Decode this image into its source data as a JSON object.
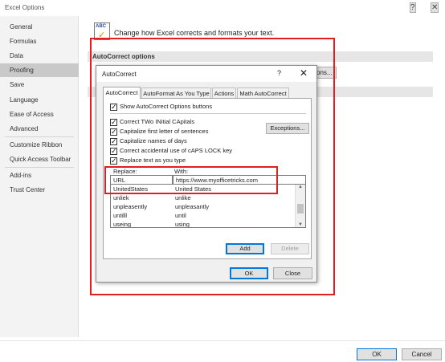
{
  "window": {
    "title": "Excel Options",
    "help_glyph": "?",
    "close_glyph": "✕"
  },
  "sidebar": {
    "items": [
      "General",
      "Formulas",
      "Data",
      "Proofing",
      "Save",
      "Language",
      "Ease of Access",
      "Advanced",
      "Customize Ribbon",
      "Quick Access Toolbar",
      "Add-ins",
      "Trust Center"
    ],
    "active": "Proofing"
  },
  "main": {
    "icon_text": "ABC",
    "heading": "Change how Excel corrects and formats your text.",
    "section_title": "AutoCorrect options",
    "options_button_partial": "ons..."
  },
  "dialog": {
    "title": "AutoCorrect",
    "help_glyph": "?",
    "close_glyph": "✕",
    "tabs": [
      "AutoCorrect",
      "AutoFormat As You Type",
      "Actions",
      "Math AutoCorrect"
    ],
    "active_tab": "AutoCorrect",
    "show_options": "Show AutoCorrect Options buttons",
    "checks": [
      "Correct TWo INitial CApitals",
      "Capitalize first letter of sentences",
      "Capitalize names of days",
      "Correct accidental use of cAPS LOCK key",
      "Replace text as you type"
    ],
    "exceptions_button": "Exceptions...",
    "replace_label": "Replace:",
    "with_label": "With:",
    "replace_value": "URL",
    "with_value": "https://www.myofficetricks.com",
    "list": [
      {
        "replace": "UnitedStates",
        "with": "United States"
      },
      {
        "replace": "unliek",
        "with": "unlike"
      },
      {
        "replace": "unpleasently",
        "with": "unpleasantly"
      },
      {
        "replace": "untilll",
        "with": "until"
      },
      {
        "replace": "useing",
        "with": "using"
      }
    ],
    "add_button": "Add",
    "delete_button": "Delete",
    "ok_button": "OK",
    "close_button": "Close"
  },
  "footer": {
    "ok_button": "OK",
    "cancel_button": "Cancel"
  }
}
